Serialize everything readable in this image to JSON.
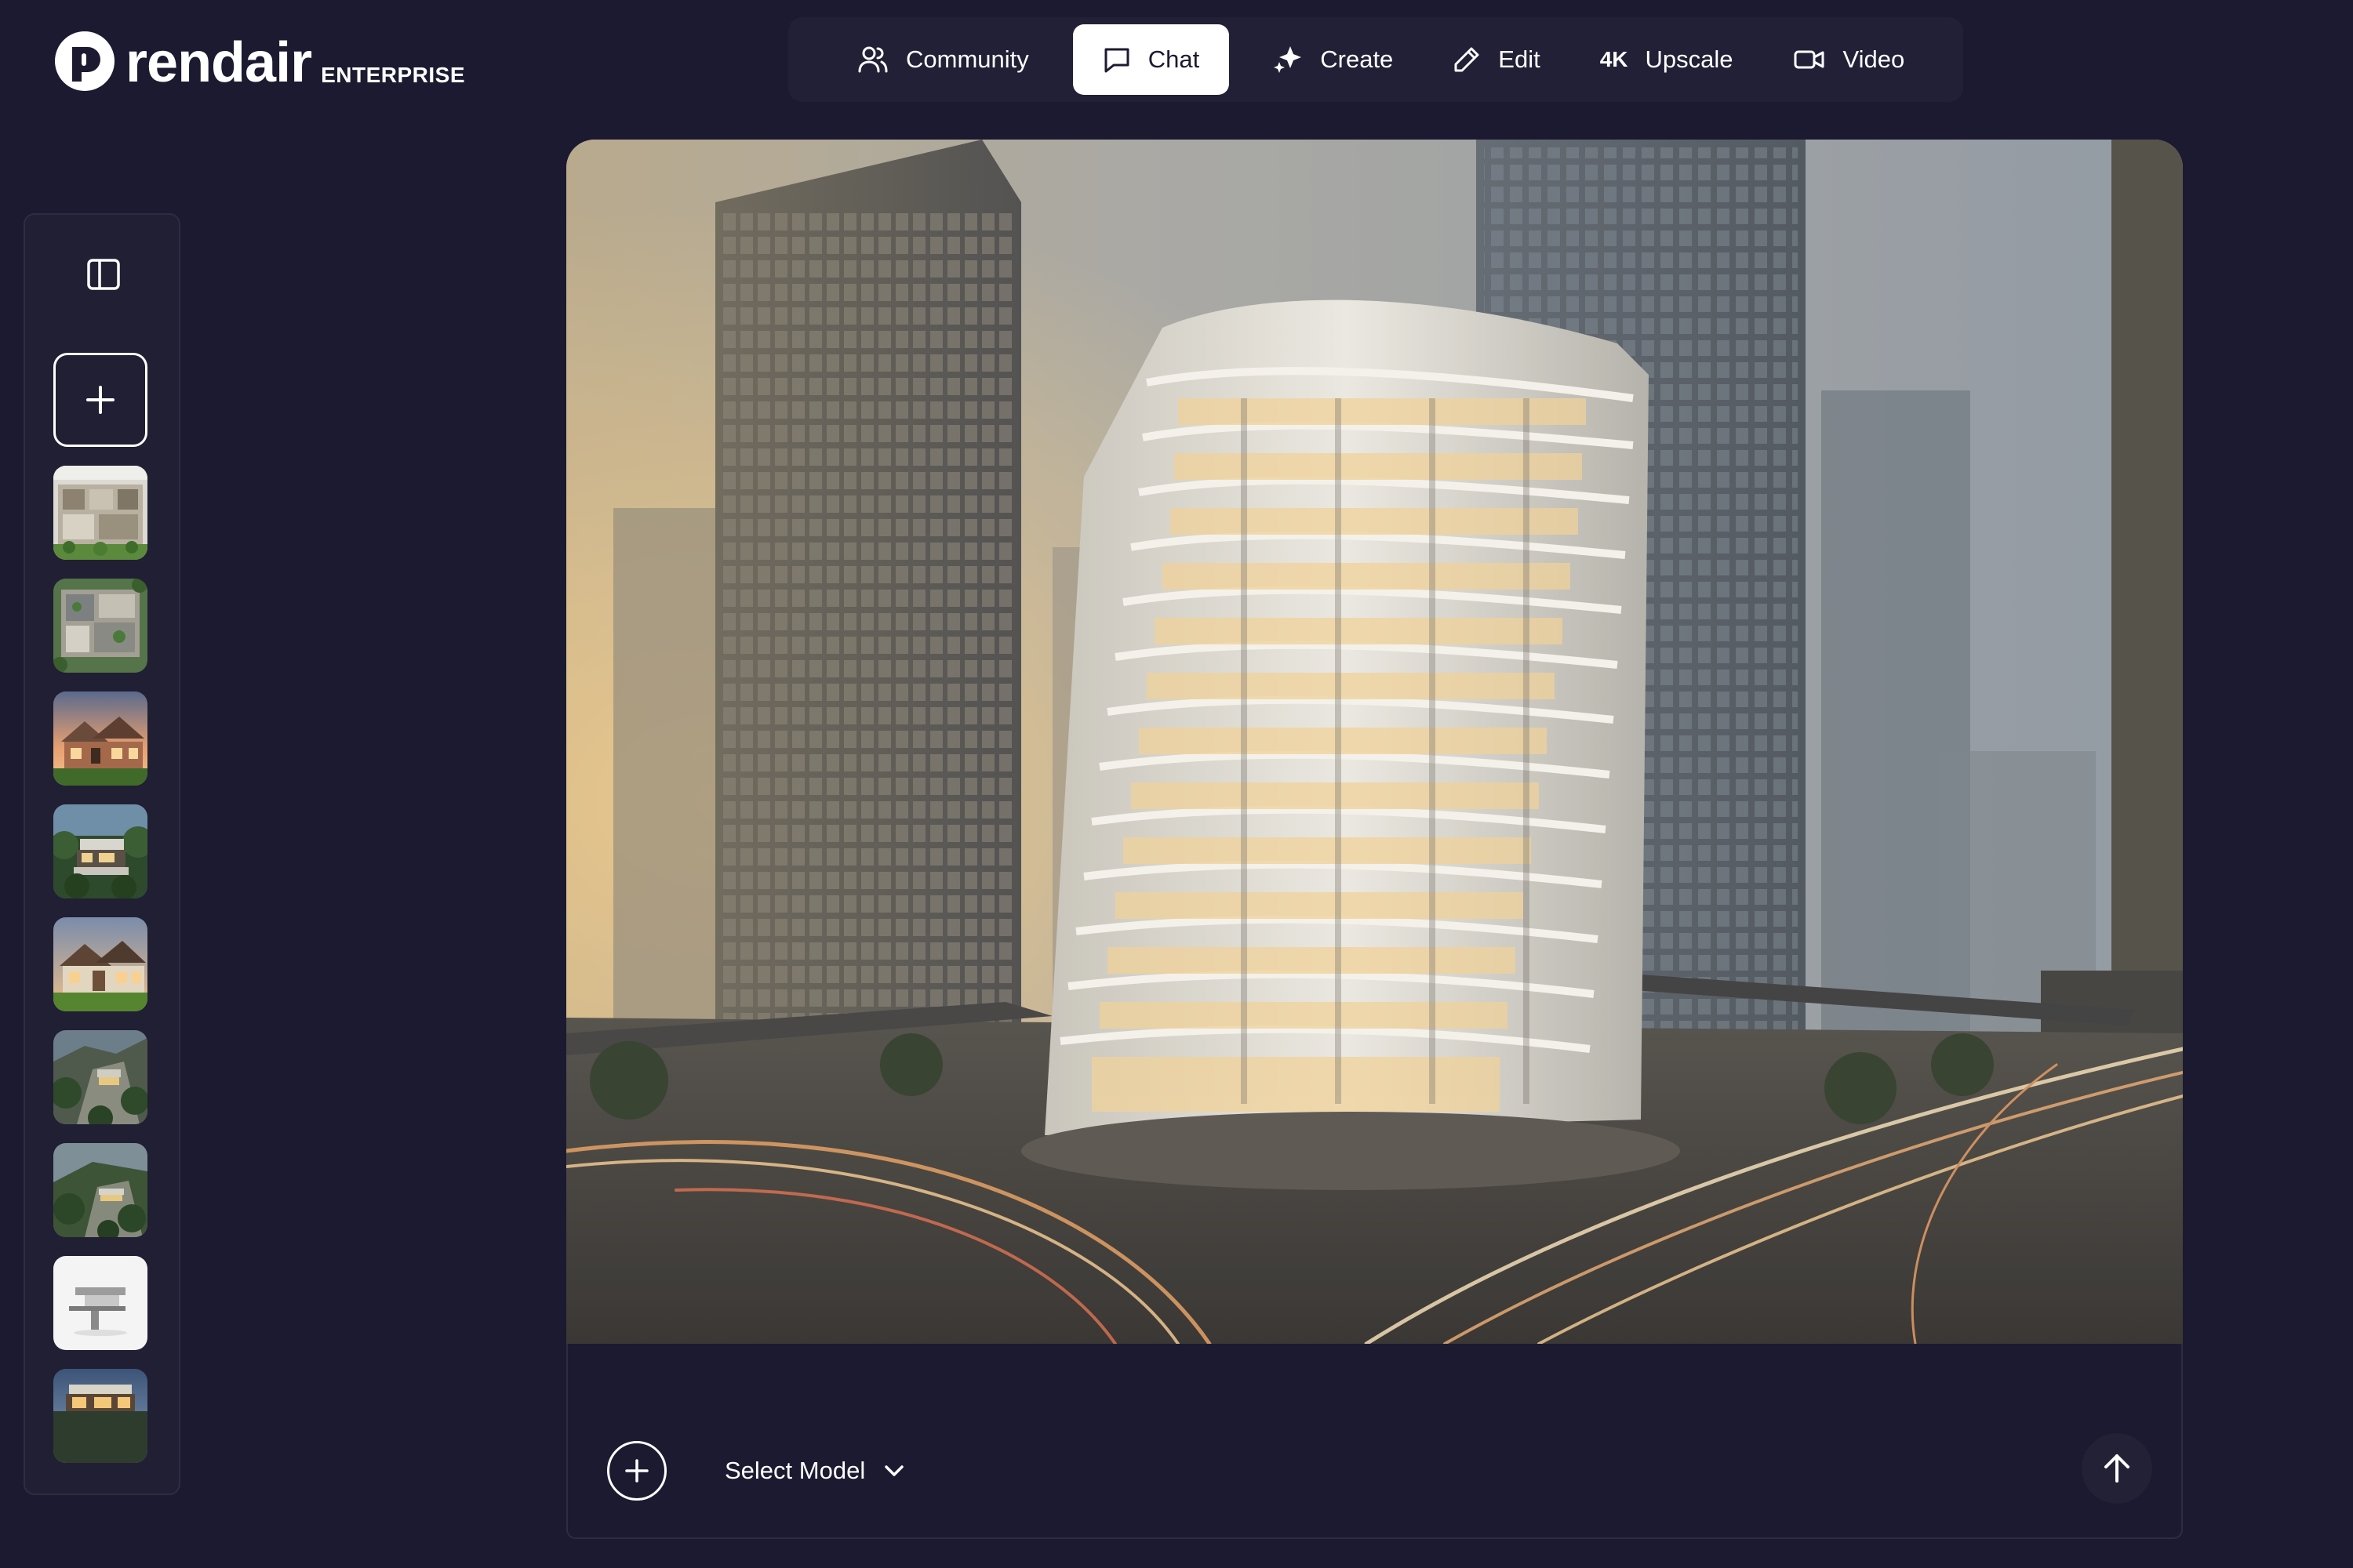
{
  "brand": {
    "name": "rendair",
    "tier": "ENTERPRISE"
  },
  "nav": {
    "items": [
      {
        "label": "Community",
        "icon": "users-icon",
        "active": false
      },
      {
        "label": "Chat",
        "icon": "chat-bubble-icon",
        "active": true
      },
      {
        "label": "Create",
        "icon": "sparkle-icon",
        "active": false
      },
      {
        "label": "Edit",
        "icon": "pencil-icon",
        "active": false
      },
      {
        "label": "Upscale",
        "prefix": "4K",
        "icon": "upscale-icon",
        "active": false
      },
      {
        "label": "Video",
        "icon": "video-camera-icon",
        "active": false
      }
    ]
  },
  "sidebar": {
    "toggle_icon": "sidebar-panel-icon",
    "new_icon": "plus-icon",
    "thumbnails": [
      {
        "subject": "floor plan aerial"
      },
      {
        "subject": "site plan aerial"
      },
      {
        "subject": "brick house at sunset"
      },
      {
        "subject": "hillside modern house"
      },
      {
        "subject": "suburban house"
      },
      {
        "subject": "rocky cliff house"
      },
      {
        "subject": "forest cliff house"
      },
      {
        "subject": "white model render"
      },
      {
        "subject": "villa at dusk"
      }
    ]
  },
  "main_image": {
    "subject": "curved white tower among skyscrapers at dusk"
  },
  "composer": {
    "attach_icon": "plus-circle-icon",
    "model_label": "Select Model",
    "model_chevron": "chevron-down-icon",
    "send_icon": "arrow-up-icon"
  },
  "colors": {
    "background": "#1c1a30",
    "panel": "#222036",
    "active_tab": "#ffffff"
  }
}
